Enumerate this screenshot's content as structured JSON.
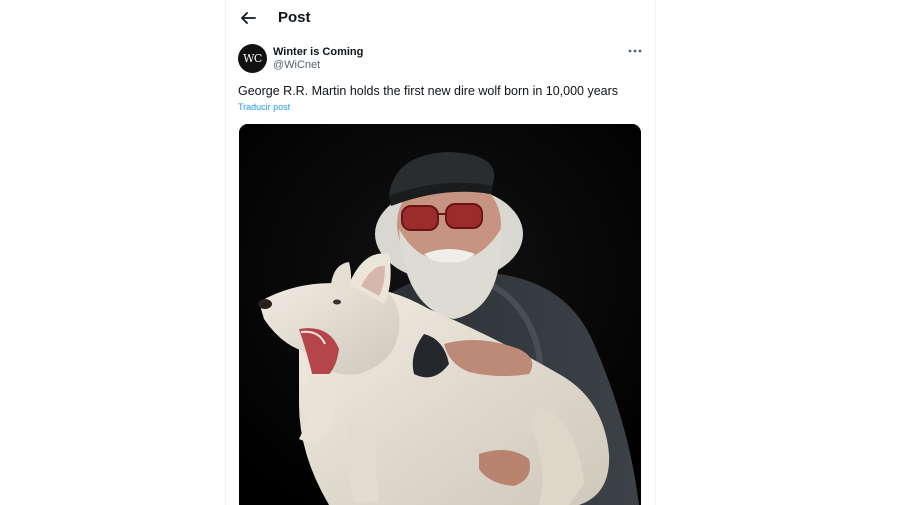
{
  "header": {
    "title": "Post",
    "back_icon": "arrow-left-icon"
  },
  "tweet": {
    "author": {
      "avatar_text": "WC",
      "display_name": "Winter is Coming",
      "handle": "@WiCnet"
    },
    "more_icon": "more-horizontal-icon",
    "text": "George R.R. Martin holds the first new dire wolf born in 10,000 years",
    "translate_label": "Traducir post",
    "media": {
      "kind": "photo",
      "icon": "photo-man-holding-white-wolf-pup"
    }
  },
  "colors": {
    "text_primary": "#0f1419",
    "text_secondary": "#536471",
    "link": "#1d9bf0",
    "border": "#eff3f4",
    "media_background": "#000000"
  }
}
